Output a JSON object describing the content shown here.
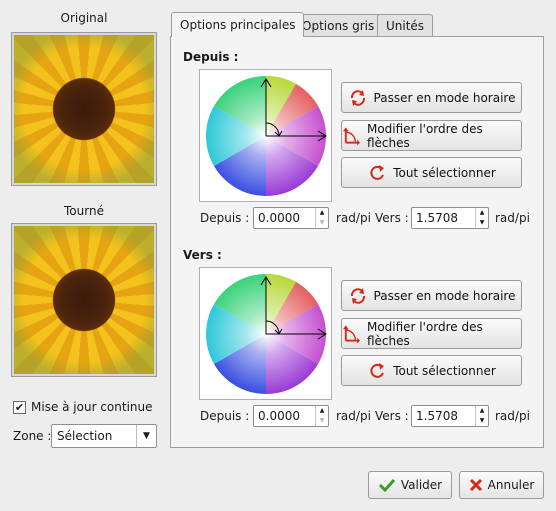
{
  "left": {
    "original_label": "Original",
    "rotated_label": "Tourné",
    "continuous_update": {
      "label": "Mise à jour continue",
      "checked": true,
      "check_glyph": "✔"
    },
    "zone": {
      "label": "Zone :",
      "value": "Sélection"
    }
  },
  "tabs": [
    {
      "label": "Options principales",
      "active": true
    },
    {
      "label": "Options gris",
      "active": false
    },
    {
      "label": "Unités",
      "active": false
    }
  ],
  "from_section": {
    "title": "Depuis :",
    "buttons": {
      "clockwise": "Passer en mode horaire",
      "swap": "Modifier l'ordre des flèches",
      "select_all": "Tout sélectionner"
    },
    "from_label": "Depuis :",
    "from_value": "0.0000",
    "from_unit": "rad/pi",
    "to_label": "Vers :",
    "to_value": "1.5708",
    "to_unit": "rad/pi"
  },
  "to_section": {
    "title": "Vers :",
    "buttons": {
      "clockwise": "Passer en mode horaire",
      "swap": "Modifier l'ordre des flèches",
      "select_all": "Tout sélectionner"
    },
    "from_label": "Depuis :",
    "from_value": "0.0000",
    "from_unit": "rad/pi",
    "to_label": "Vers :",
    "to_value": "1.5708",
    "to_unit": "rad/pi"
  },
  "footer": {
    "ok_label": "Valider",
    "cancel_label": "Annuler"
  },
  "colors": {
    "accent_red": "#d42a1c",
    "ok_green": "#3b9a2a"
  }
}
